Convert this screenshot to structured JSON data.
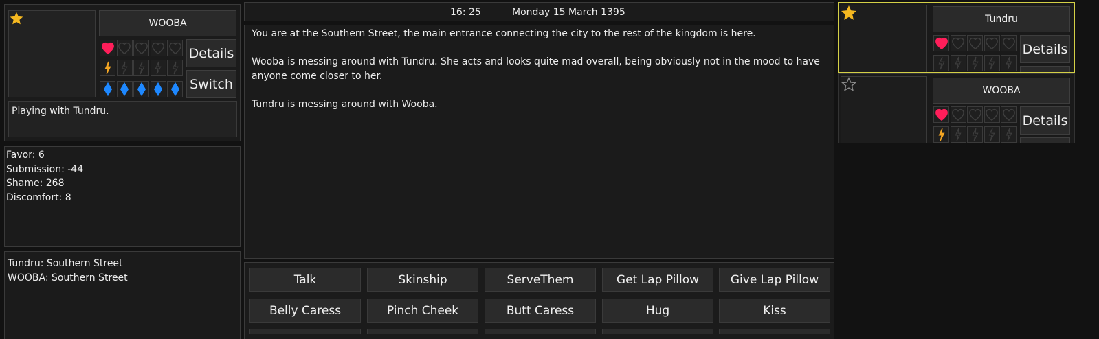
{
  "colors": {
    "star": "#f5b820",
    "heart": "#ff1e5a",
    "bolt": "#f5a623",
    "diamond": "#1e88ff",
    "highlight": "#d4d046"
  },
  "left": {
    "selected_name": "WOOBA",
    "details_label": "Details",
    "switch_label": "Switch",
    "activity": "Playing with Tundru.",
    "stats": [
      "Favor: 6",
      "Submission: -44",
      "Shame: 268",
      "Discomfort: 8"
    ],
    "locations": [
      "Tundru: Southern Street",
      "WOOBA: Southern Street"
    ],
    "hearts_filled": 1,
    "bolts_filled": 1,
    "diamonds_filled": 5
  },
  "clock": {
    "time": "16: 25",
    "date": "Monday 15  March 1395"
  },
  "narrative": {
    "p1": "You are at the Southern Street, the main entrance connecting the city to the rest of the kingdom is here.",
    "p2": "Wooba is messing around with Tundru. She acts and looks quite mad overall, being obviously not in the mood to have\nanyone come closer to her.",
    "p3": "Tundru is messing around with Wooba."
  },
  "actions": [
    "Talk",
    "Skinship",
    "ServeThem",
    "Get Lap Pillow",
    "Give Lap Pillow",
    "Belly Caress",
    "Pinch Cheek",
    "Butt Caress",
    "Hug",
    "Kiss"
  ],
  "party": [
    {
      "name": "Tundru",
      "details_label": "Details",
      "favorite": true,
      "hearts_filled": 1,
      "bolts_filled": 0
    },
    {
      "name": "WOOBA",
      "details_label": "Details",
      "favorite": false,
      "hearts_filled": 1,
      "bolts_filled": 1
    }
  ]
}
